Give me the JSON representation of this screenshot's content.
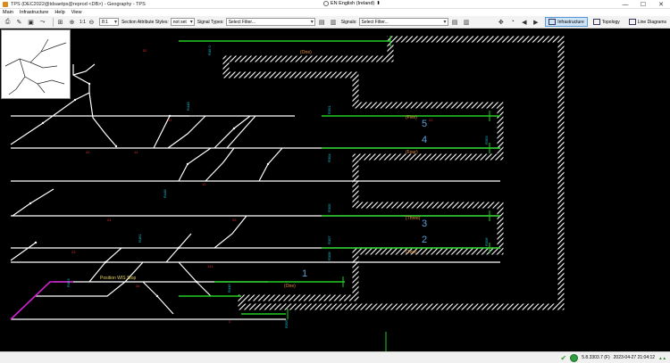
{
  "window": {
    "title": "TPS (DEC2022@tdsaetps@reprod <DB>) - Geography - TPS",
    "language": "EN English (Ireland)",
    "minimize": "—",
    "maximize": "☐",
    "close": "✕"
  },
  "menu": [
    "Main",
    "Infrastructure",
    "Help",
    "View"
  ],
  "toolbar": {
    "zoom_label": "1:1",
    "scale_value": "8:1",
    "section_styles_label": "Section Attribute Styles:",
    "section_styles_value": "not set",
    "signal_types_label": "Signal Types:",
    "signal_types_placeholder": "Select Filter...",
    "signals_label": "Signals:",
    "signals_placeholder": "Select Filter...",
    "views": [
      "Infrastructure",
      "Topology",
      "Line Diagrams"
    ]
  },
  "map": {
    "platform_numbers": [
      "5",
      "4",
      "3",
      "2",
      "1"
    ],
    "platform_tags": [
      "(Five)",
      "(Four)",
      "(Three)",
      "(Two)",
      "(One)",
      "(One)"
    ],
    "annotation": "Position WIS Stop",
    "colors": {
      "background": "#000000",
      "track": "#ffffff",
      "platform_track": "#22cc22",
      "signal_label": "#22c0d8",
      "red_label": "#d23030",
      "branch": "#d020d0"
    }
  },
  "status": {
    "version": "5.8.3303.7 (F)",
    "timestamp": "2023-04-27 21:04:12"
  }
}
